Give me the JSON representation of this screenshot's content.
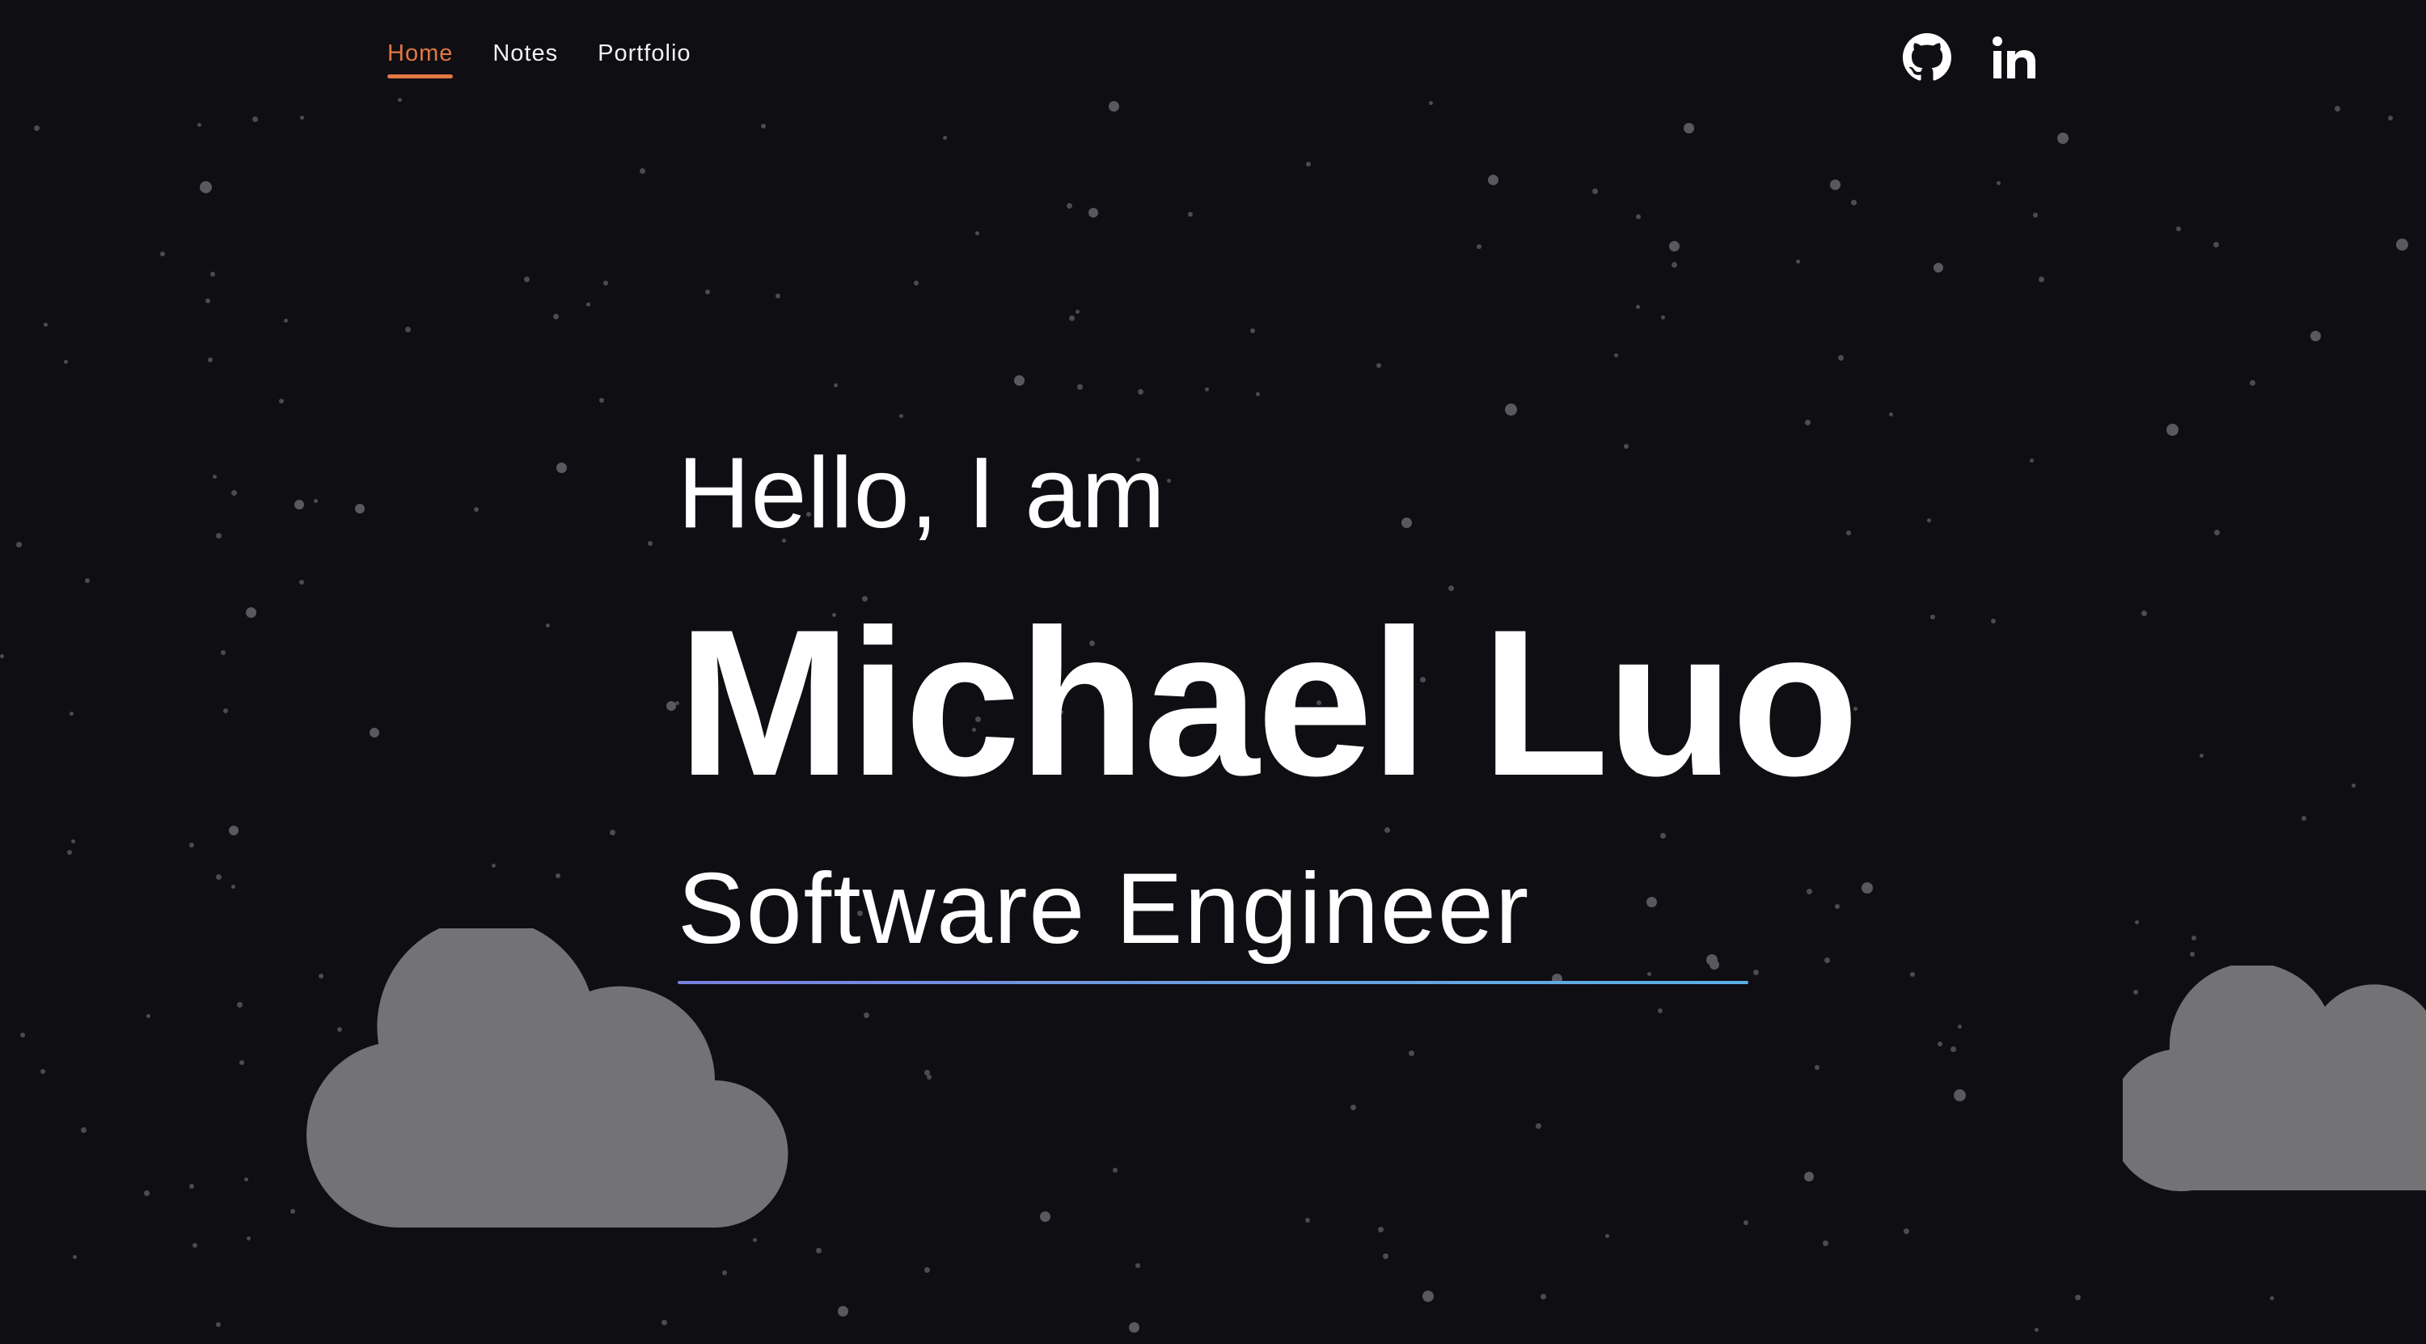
{
  "nav": {
    "items": [
      {
        "label": "Home",
        "active": true
      },
      {
        "label": "Notes",
        "active": false
      },
      {
        "label": "Portfolio",
        "active": false
      }
    ],
    "social": [
      {
        "icon": "github-icon"
      },
      {
        "icon": "linkedin-icon"
      }
    ]
  },
  "hero": {
    "greeting": "Hello, I am",
    "name": "Michael Luo",
    "role": "Software Engineer"
  },
  "colors": {
    "background": "#0f0e13",
    "accent": "#e27842",
    "cloud": "#737275",
    "star": "#4d4b52",
    "text": "#ffffff"
  }
}
